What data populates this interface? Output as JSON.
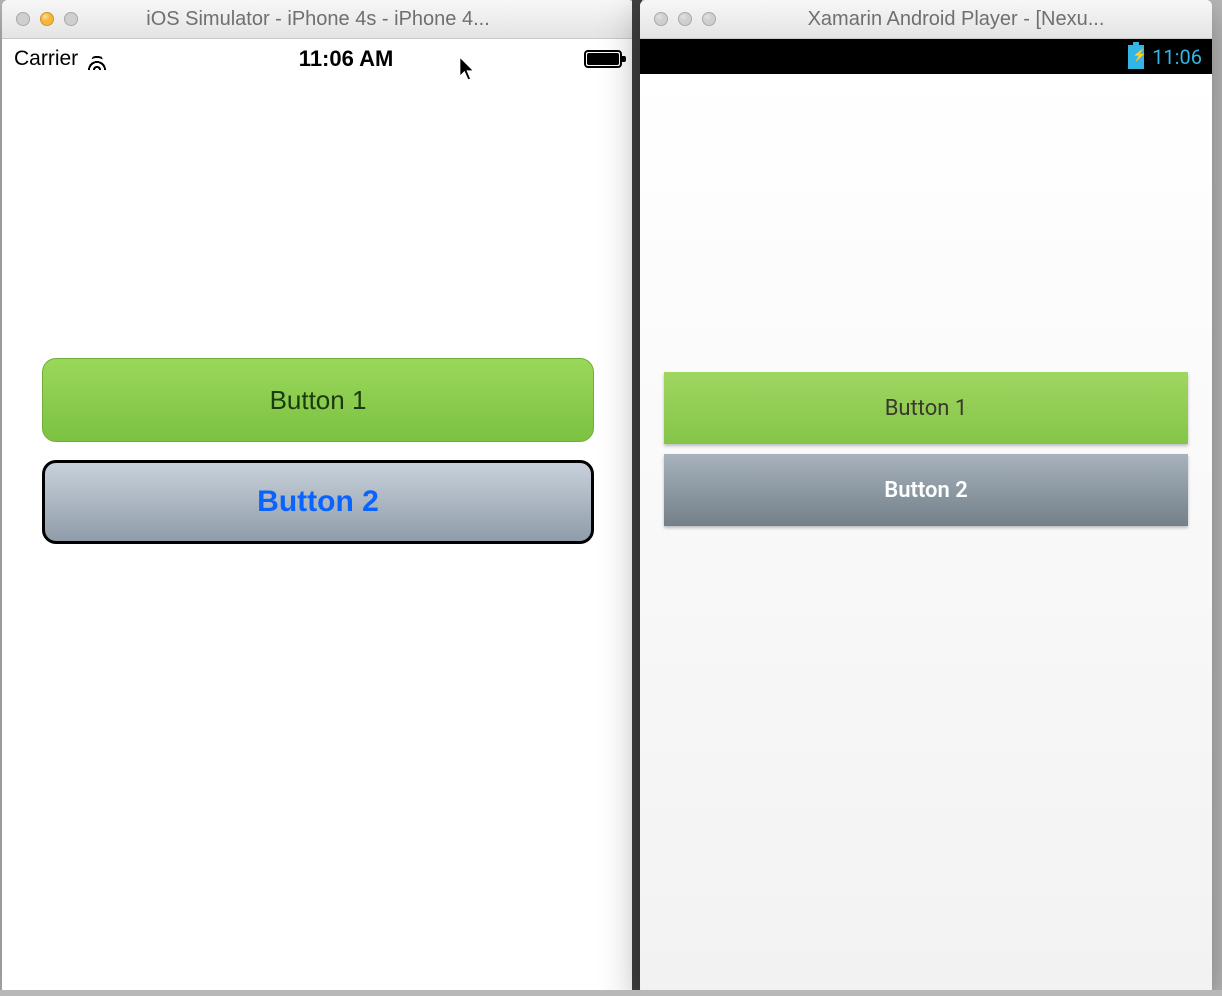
{
  "ios": {
    "window_title": "iOS Simulator - iPhone 4s - iPhone 4...",
    "status": {
      "carrier": "Carrier",
      "time": "11:06 AM"
    },
    "buttons": {
      "b1": "Button 1",
      "b2": "Button 2"
    }
  },
  "android": {
    "window_title": "Xamarin Android Player - [Nexu...",
    "status": {
      "time": "11:06"
    },
    "buttons": {
      "b1": "Button 1",
      "b2": "Button 2"
    }
  }
}
